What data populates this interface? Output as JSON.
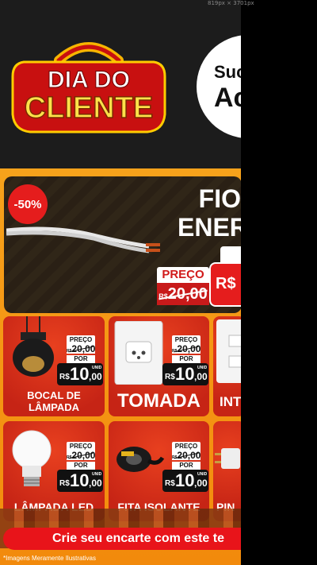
{
  "logo": {
    "line1": "DIA DO",
    "line2": "CLIENTE"
  },
  "circle": {
    "line1": "Suc",
    "line2": "Ac"
  },
  "featured": {
    "badge": "-50%",
    "title1": "FIO",
    "title2": "ENER",
    "preco_label": "PREÇO",
    "old_price_rs": "R$",
    "old_price": "20,00",
    "new_price": "R$ 1"
  },
  "products": [
    {
      "name1": "BOCAL DE",
      "name2": "LÂMPADA",
      "preco": "PREÇO",
      "old": "20,00",
      "por": "POR",
      "new_int": "10",
      "new_cents": ",00",
      "unid": "UNID"
    },
    {
      "name1": "TOMADA",
      "name2": "",
      "preco": "PREÇO",
      "old": "20,00",
      "por": "POR",
      "new_int": "10",
      "new_cents": ",00",
      "unid": "UNID"
    },
    {
      "name1": "INT",
      "name2": ""
    },
    {
      "name1": "LÂMPADA LED",
      "name2": "",
      "preco": "PREÇO",
      "old": "20,00",
      "por": "POR",
      "new_int": "10",
      "new_cents": ",00",
      "unid": "UNID"
    },
    {
      "name1": "FITA ISOLANTE",
      "name2": "",
      "preco": "PREÇO",
      "old": "20,00",
      "por": "POR",
      "new_int": "10",
      "new_cents": ",00",
      "unid": "UNID"
    },
    {
      "name1": "PIN",
      "name2": ""
    }
  ],
  "currency": "R$",
  "banner": "Crie seu encarte com este te",
  "footnote": "*Imagens Meramente Ilustrativas",
  "dimension_note": "819px × 3701px"
}
